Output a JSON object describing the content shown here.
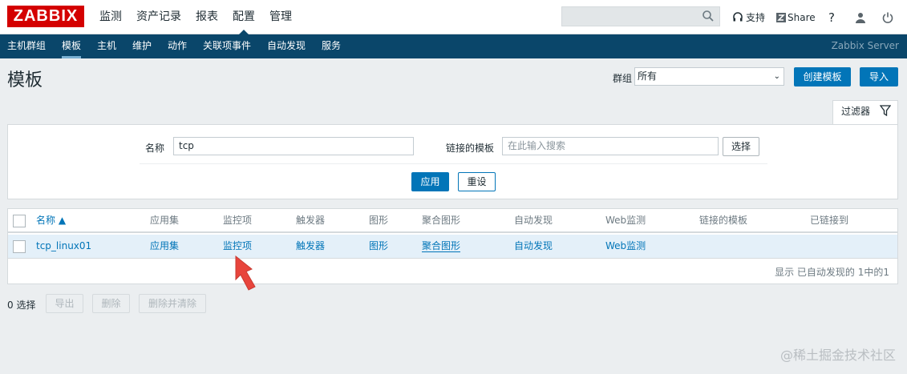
{
  "header": {
    "logo_text": "ZABBIX",
    "menu": [
      "监测",
      "资产记录",
      "报表",
      "配置",
      "管理"
    ],
    "active_menu": "配置",
    "search_placeholder": "",
    "support_label": "支持",
    "share_label": "Share",
    "help_label": "?"
  },
  "submenu": {
    "items": [
      "主机群组",
      "模板",
      "主机",
      "维护",
      "动作",
      "关联项事件",
      "自动发现",
      "服务"
    ],
    "active": "模板",
    "server_name": "Zabbix Server"
  },
  "page": {
    "title": "模板",
    "group_label": "群组",
    "group_value": "所有",
    "create_button": "创建模板",
    "import_button": "导入"
  },
  "filter": {
    "tab_label": "过滤器",
    "name_label": "名称",
    "name_value": "tcp",
    "linked_label": "链接的模板",
    "linked_placeholder": "在此输入搜索",
    "select_button": "选择",
    "apply_button": "应用",
    "reset_button": "重设"
  },
  "table": {
    "columns": [
      "名称 ▲",
      "应用集",
      "监控项",
      "触发器",
      "图形",
      "聚合图形",
      "自动发现",
      "Web监测",
      "链接的模板",
      "已链接到"
    ],
    "rows": [
      [
        "tcp_linux01",
        "应用集",
        "监控项",
        "触发器",
        "图形",
        "聚合图形",
        "自动发现",
        "Web监测",
        "",
        ""
      ]
    ],
    "footer": "显示 已自动发现的 1中的1"
  },
  "actions": {
    "selected": "0 选择",
    "export": "导出",
    "delete": "删除",
    "delete_clear": "删除并清除"
  },
  "watermark": "@稀土掘金技术社区",
  "colors": {
    "brand_red": "#d40000",
    "nav_blue": "#0a466a",
    "link_blue": "#0275b8",
    "row_highlight": "#e4f0f9",
    "arrow_red": "#e8453c"
  }
}
